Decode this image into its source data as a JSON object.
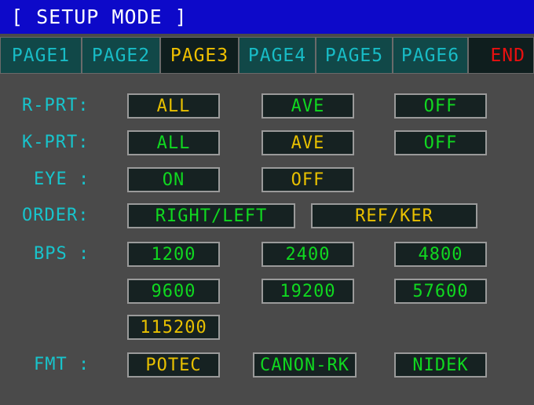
{
  "title": "[ SETUP MODE ]",
  "tabs": [
    "PAGE1",
    "PAGE2",
    "PAGE3",
    "PAGE4",
    "PAGE5",
    "PAGE6"
  ],
  "end_label": "END",
  "rows": {
    "r_prt": {
      "label": "R-PRT:",
      "options": [
        "ALL",
        "AVE",
        "OFF"
      ],
      "selected": "ALL"
    },
    "k_prt": {
      "label": "K-PRT:",
      "options": [
        "ALL",
        "AVE",
        "OFF"
      ],
      "selected": "AVE"
    },
    "eye": {
      "label": "EYE :",
      "options": [
        "ON",
        "OFF"
      ],
      "selected": "OFF"
    },
    "order": {
      "label": "ORDER:",
      "options": [
        "RIGHT/LEFT",
        "REF/KER"
      ],
      "selected": "REF/KER"
    },
    "bps": {
      "label": "BPS :",
      "options": [
        "1200",
        "2400",
        "4800",
        "9600",
        "19200",
        "57600",
        "115200"
      ],
      "selected": "115200"
    },
    "fmt": {
      "label": "FMT :",
      "options": [
        "POTEC",
        "CANON-RK",
        "NIDEK"
      ],
      "selected": "POTEC"
    }
  },
  "colors": {
    "title_bar": "#0d09c9",
    "label": "#18c4cc",
    "selected": "#e8c000",
    "unselected": "#10d820",
    "end": "#e81010"
  }
}
